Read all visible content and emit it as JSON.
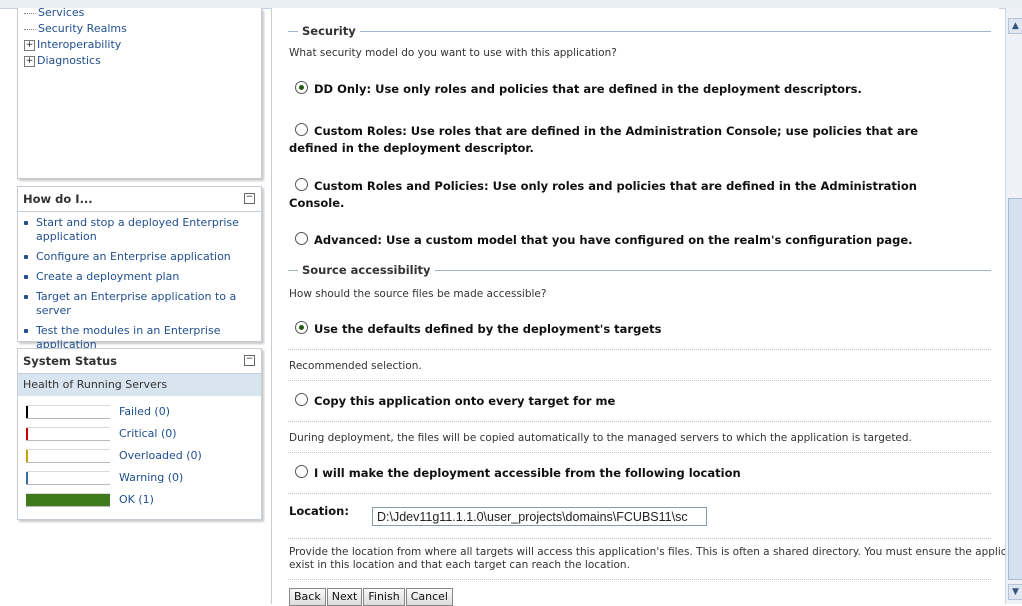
{
  "tree": {
    "items": [
      {
        "label": "Security Realms",
        "expandable": false
      },
      {
        "label": "Interoperability",
        "expandable": true
      },
      {
        "label": "Diagnostics",
        "expandable": true
      }
    ]
  },
  "howdoi": {
    "title": "How do I...",
    "links": [
      "Start and stop a deployed Enterprise application",
      "Configure an Enterprise application",
      "Create a deployment plan",
      "Target an Enterprise application to a server",
      "Test the modules in an Enterprise application"
    ]
  },
  "system_status": {
    "title": "System Status",
    "health_label": "Health of Running Servers",
    "rows": [
      {
        "label": "Failed (0)",
        "color": "#000000",
        "value": 0
      },
      {
        "label": "Critical (0)",
        "color": "#cc0000",
        "value": 0
      },
      {
        "label": "Overloaded (0)",
        "color": "#c8a400",
        "value": 0
      },
      {
        "label": "Warning (0)",
        "color": "#3a6aa0",
        "value": 0
      },
      {
        "label": "OK (1)",
        "color": "#3f7a1c",
        "value": 1
      }
    ]
  },
  "security": {
    "title": "Security",
    "question": "What security model do you want to use with this application?",
    "options": [
      {
        "line1": "DD Only: Use only roles and policies that are defined in the deployment descriptors.",
        "line2": "",
        "selected": true
      },
      {
        "line1": "Custom Roles: Use roles that are defined in the Administration Console; use policies that are",
        "line2": "defined in the deployment descriptor.",
        "selected": false
      },
      {
        "line1": "Custom Roles and Policies: Use only roles and policies that are defined in the Administration",
        "line2": "Console.",
        "selected": false
      },
      {
        "line1": "Advanced: Use a custom model that you have configured on the realm's configuration page.",
        "line2": "",
        "selected": false
      }
    ]
  },
  "source": {
    "title": "Source accessibility",
    "question": "How should the source files be made accessible?",
    "opt1": "Use the defaults defined by the deployment's targets",
    "opt1_note": "Recommended selection.",
    "opt2": "Copy this application onto every target for me",
    "opt2_note": "During deployment, the files will be copied automatically to the managed servers to which the application is targeted.",
    "opt3": "I will make the deployment accessible from the following location",
    "location_label": "Location:",
    "location_value": "D:\\Jdev11g11.1.1.0\\user_projects\\domains\\FCUBS11\\sc",
    "help_line1": "Provide the location from where all targets will access this application's files. This is often a shared directory. You must ensure the application files",
    "help_line2": "exist in this location and that each target can reach the location."
  },
  "buttons": {
    "back": "Back",
    "next": "Next",
    "finish": "Finish",
    "cancel": "Cancel"
  }
}
